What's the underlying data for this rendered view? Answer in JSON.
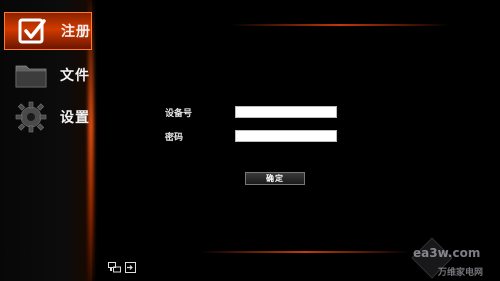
{
  "sidebar": {
    "items": [
      {
        "label": "注册",
        "icon": "register-checkbox-icon",
        "active": true
      },
      {
        "label": "文件",
        "icon": "folder-icon",
        "active": false
      },
      {
        "label": "设置",
        "icon": "gear-icon",
        "active": false
      }
    ]
  },
  "form": {
    "device_label": "设备号",
    "device_value": "",
    "password_label": "密码",
    "password_value": "",
    "confirm_label": "确定"
  },
  "status_icons": [
    "network-icon",
    "input-icon"
  ],
  "watermark": {
    "logo_text": "ea3w.com",
    "caption": "万维家电网"
  },
  "colors": {
    "accent": "#d23b00",
    "glow": "#ff5a14",
    "background": "#000000"
  }
}
